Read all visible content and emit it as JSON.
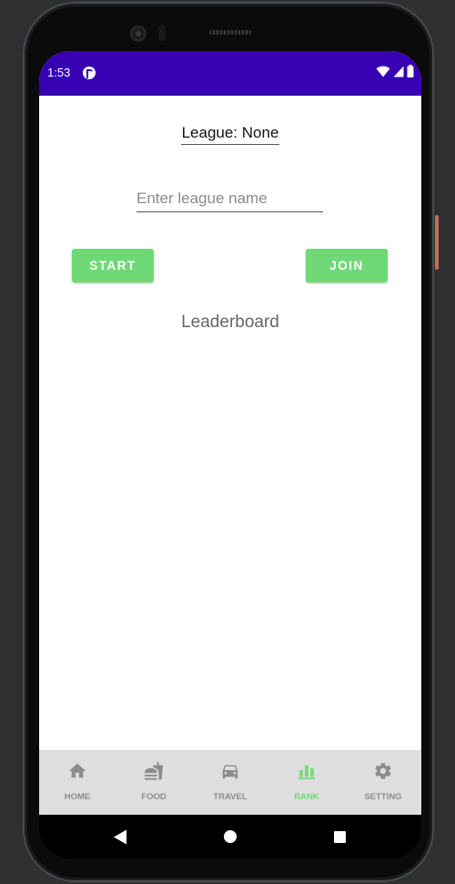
{
  "status_bar": {
    "time": "1:53",
    "background": "#3700b3",
    "icons": [
      "app-notification-icon",
      "wifi-icon",
      "signal-icon",
      "battery-icon"
    ]
  },
  "league": {
    "title": "League: None",
    "input_placeholder": "Enter league name",
    "input_value": ""
  },
  "actions": {
    "start_label": "START",
    "join_label": "JOIN",
    "button_color": "#6fd977"
  },
  "leaderboard": {
    "title": "Leaderboard"
  },
  "bottom_nav": {
    "active": "RANK",
    "active_color": "#6fd977",
    "items": [
      {
        "label": "HOME",
        "icon": "home-icon"
      },
      {
        "label": "FOOD",
        "icon": "food-icon"
      },
      {
        "label": "TRAVEL",
        "icon": "car-icon"
      },
      {
        "label": "RANK",
        "icon": "bar-chart-icon"
      },
      {
        "label": "SETTING",
        "icon": "gear-icon"
      }
    ]
  },
  "system_nav": {
    "icons": [
      "back-icon",
      "home-circle-icon",
      "recents-icon"
    ]
  }
}
